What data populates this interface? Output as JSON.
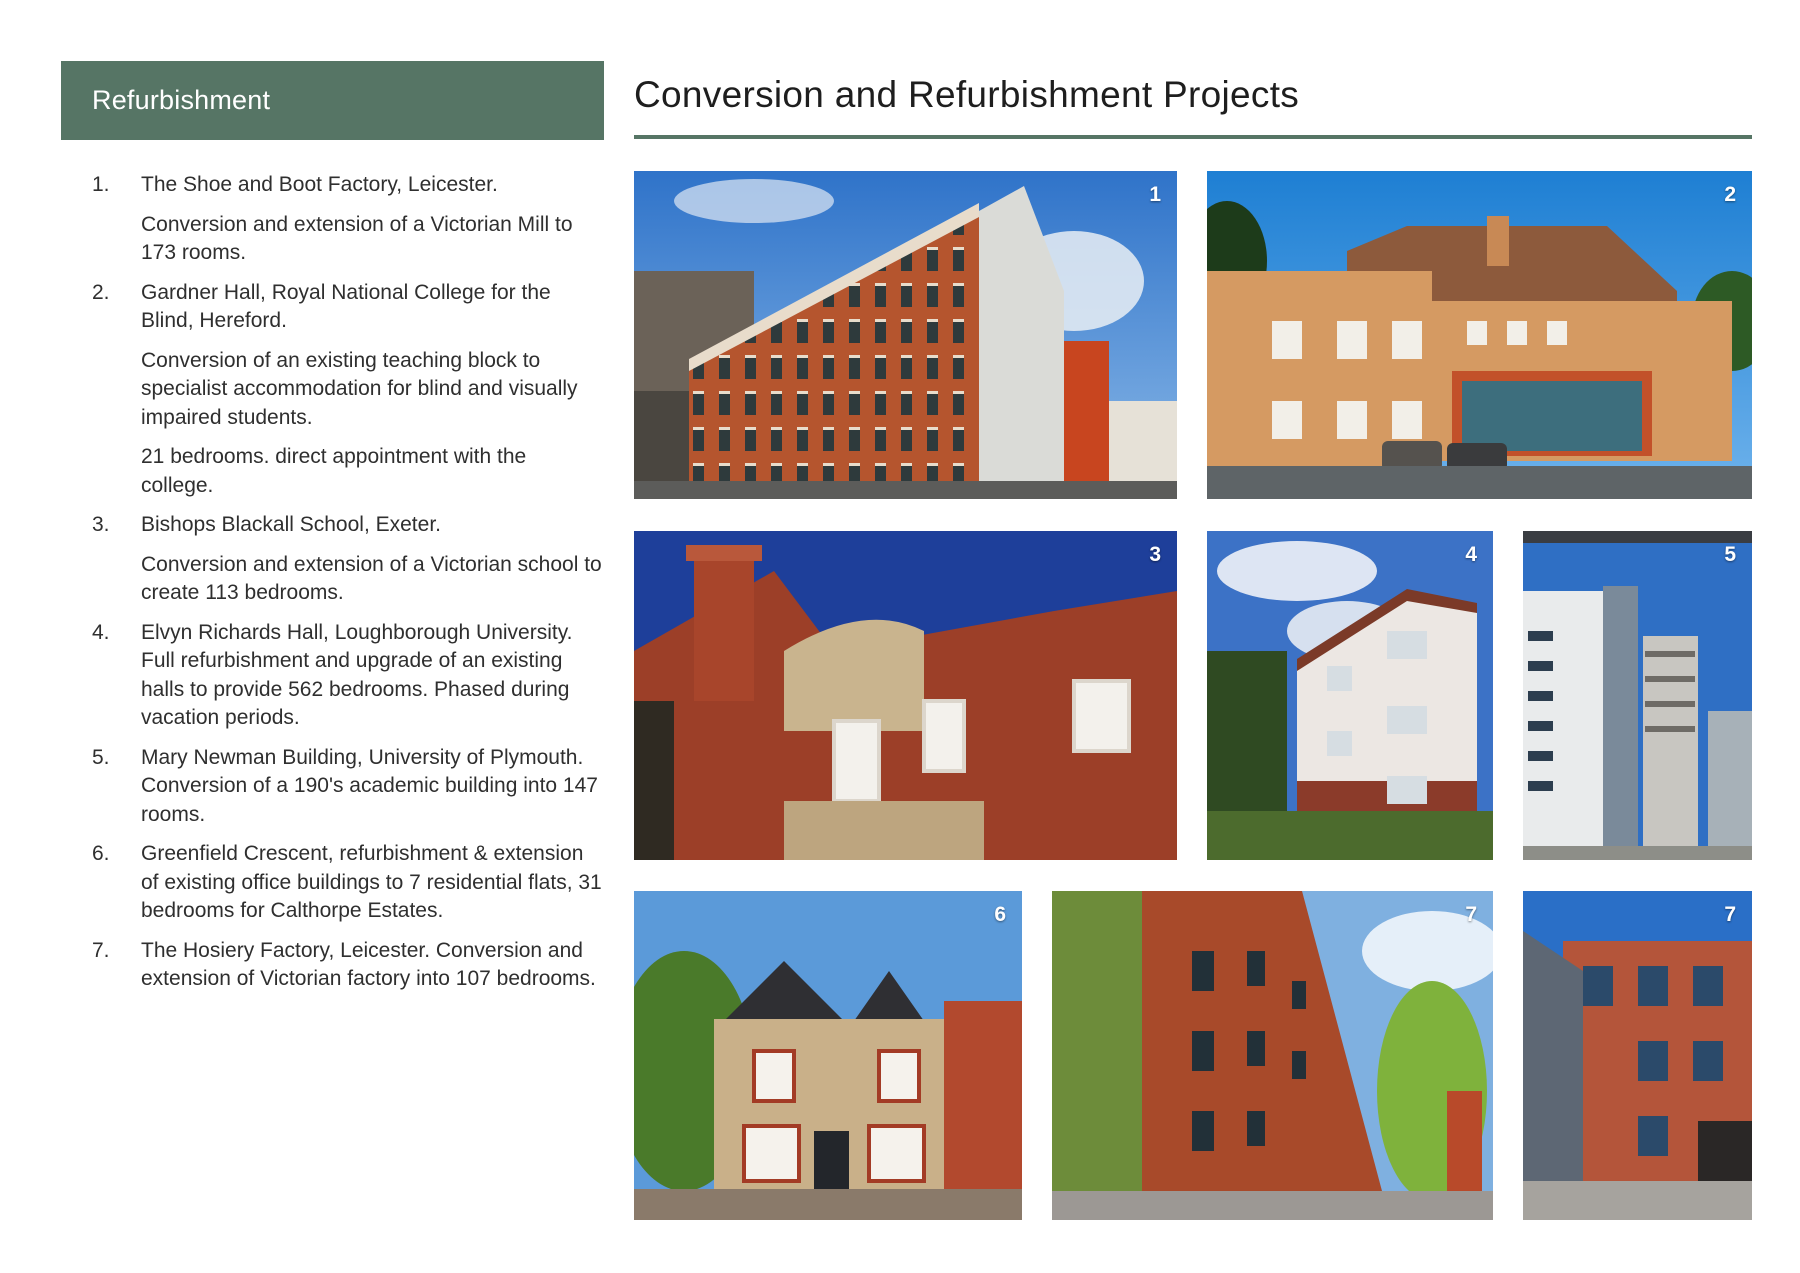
{
  "sidebar": {
    "title": "Refurbishment"
  },
  "page": {
    "title": "Conversion and Refurbishment Projects"
  },
  "projects": [
    {
      "number": "1.",
      "paragraphs": [
        "The Shoe and Boot Factory, Leicester.",
        "Conversion and extension of a Victorian Mill to 173 rooms."
      ]
    },
    {
      "number": "2.",
      "paragraphs": [
        "Gardner Hall, Royal National College for the Blind, Hereford.",
        "Conversion of an existing teaching block to specialist accommodation for blind and visually impaired students.",
        "21 bedrooms. direct appointment with the college."
      ]
    },
    {
      "number": "3.",
      "paragraphs": [
        "Bishops Blackall School, Exeter.",
        "Conversion and extension of a Victorian school to create 113 bedrooms."
      ]
    },
    {
      "number": "4.",
      "paragraphs": [
        "Elvyn Richards Hall, Loughborough University. Full refurbishment and upgrade of an existing halls to provide 562 bedrooms. Phased during vacation periods."
      ]
    },
    {
      "number": "5.",
      "paragraphs": [
        "Mary Newman Building, University of Plymouth. Conversion of a 190's academic building into 147 rooms."
      ]
    },
    {
      "number": "6.",
      "paragraphs": [
        "Greenfield Crescent, refurbishment & extension of existing office buildings to 7 residential flats, 31 bedrooms for Calthorpe Estates."
      ]
    },
    {
      "number": "7.",
      "paragraphs": [
        "The Hosiery Factory, Leicester.  Conversion and extension of Victorian factory into 107 bedrooms."
      ]
    }
  ],
  "photos": [
    {
      "badge": "1",
      "subject": "victorian-mill-building"
    },
    {
      "badge": "2",
      "subject": "gardner-hall-building"
    },
    {
      "badge": "3",
      "subject": "victorian-school-building"
    },
    {
      "badge": "4",
      "subject": "residence-hall-building"
    },
    {
      "badge": "5",
      "subject": "tower-block-building"
    },
    {
      "badge": "6",
      "subject": "victorian-house-building"
    },
    {
      "badge": "7",
      "subject": "hosiery-factory-street"
    },
    {
      "badge": "7",
      "subject": "hosiery-factory-courtyard"
    }
  ]
}
